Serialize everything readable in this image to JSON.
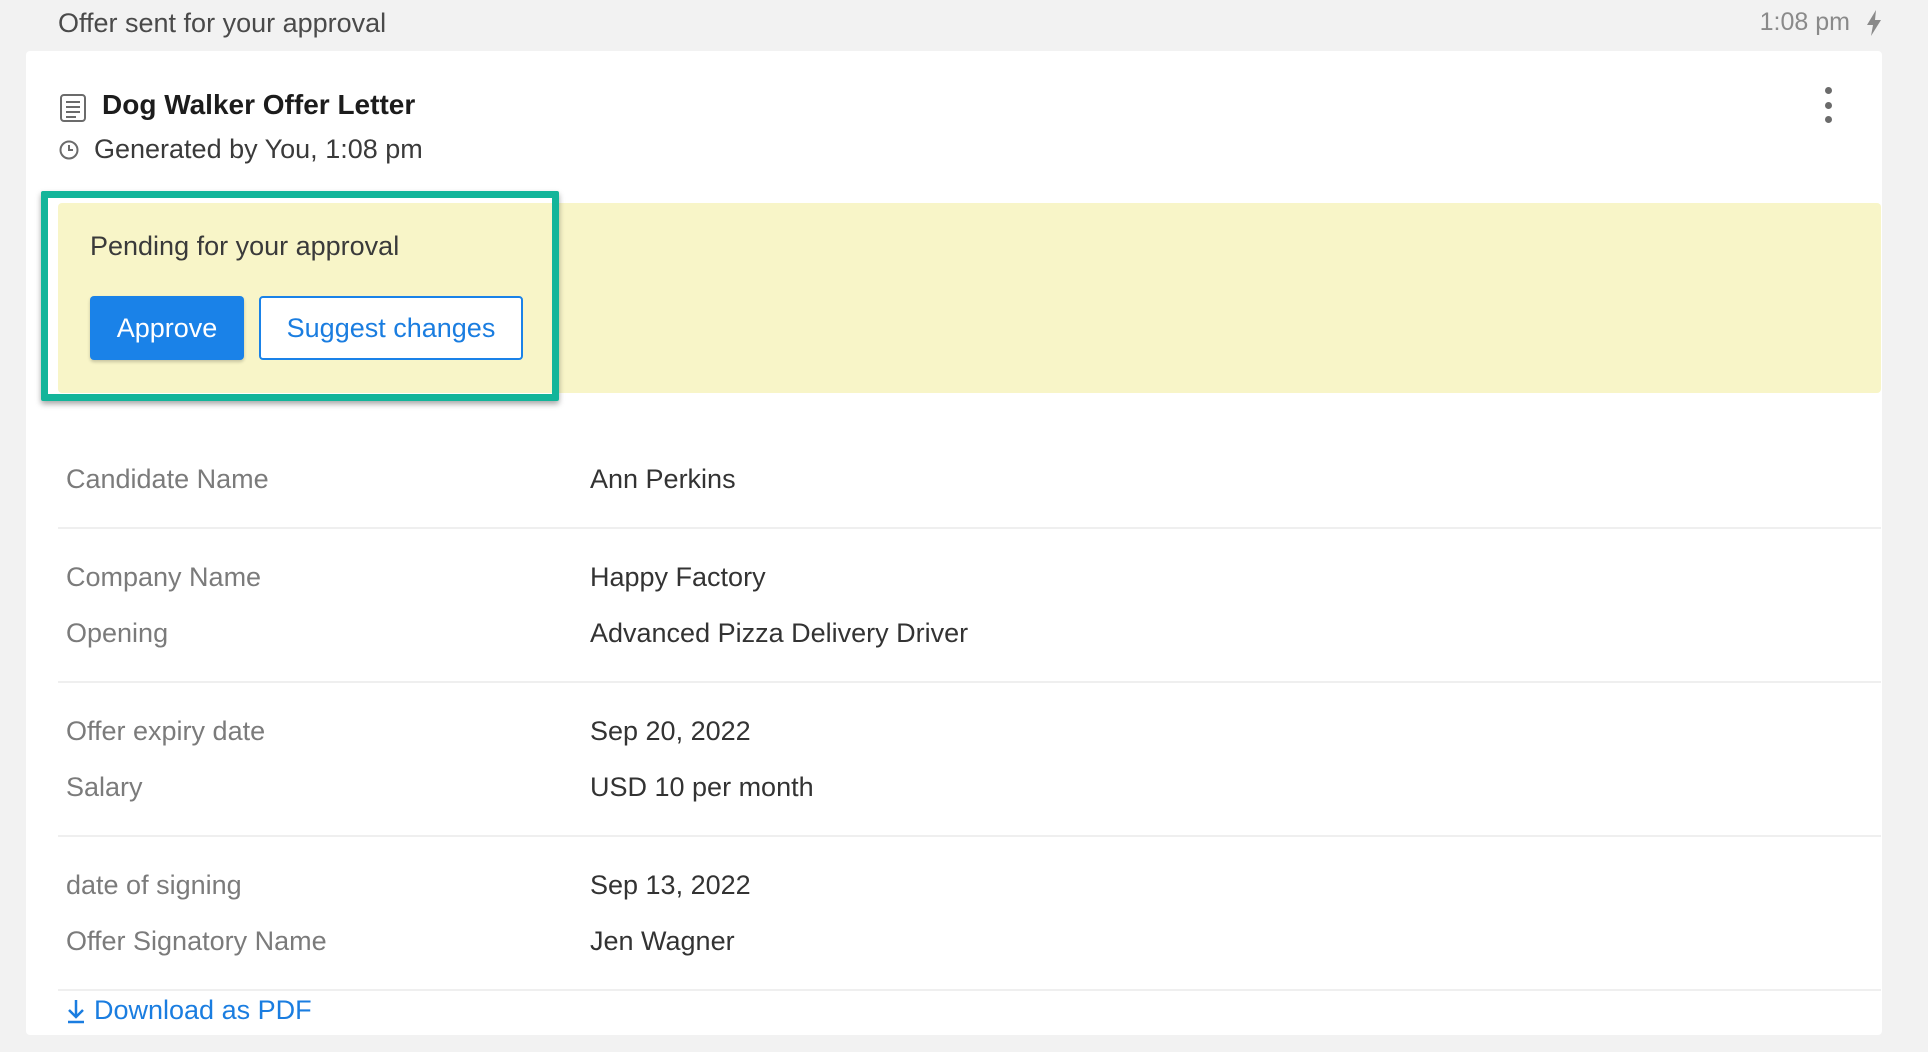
{
  "header": {
    "title": "Offer sent for your approval",
    "time": "1:08 pm",
    "icon": "lightning-icon"
  },
  "card": {
    "icon": "document-icon",
    "title": "Dog Walker Offer Letter",
    "subtitle": "Generated by You, 1:08 pm",
    "subtitle_icon": "clock-icon"
  },
  "approval": {
    "status_text": "Pending for your approval",
    "approve_label": "Approve",
    "suggest_label": "Suggest changes",
    "colors": {
      "banner": "#f8f5c8",
      "highlight": "#13b59a",
      "primary": "#1a82e8"
    }
  },
  "details": {
    "groups": [
      [
        {
          "label": "Candidate Name",
          "value": "Ann Perkins"
        }
      ],
      [
        {
          "label": "Company Name",
          "value": "Happy Factory"
        },
        {
          "label": "Opening",
          "value": "Advanced Pizza Delivery Driver"
        }
      ],
      [
        {
          "label": "Offer expiry date",
          "value": "Sep 20, 2022"
        },
        {
          "label": "Salary",
          "value": "USD 10 per month"
        }
      ],
      [
        {
          "label": "date of signing",
          "value": "Sep 13, 2022"
        },
        {
          "label": "Offer Signatory Name",
          "value": "Jen Wagner"
        }
      ]
    ]
  },
  "download": {
    "label": "Download as PDF",
    "icon": "download-icon"
  }
}
